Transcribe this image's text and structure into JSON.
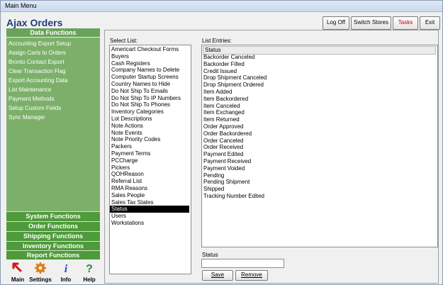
{
  "window": {
    "title": "Main Menu"
  },
  "app": {
    "title": "Ajax Orders"
  },
  "toolbar": {
    "logoff": "Log Off",
    "switch_stores": "Switch Stores",
    "tasks": "Tasks",
    "exit": "Exit",
    "tasks_color": "#c00000"
  },
  "sidebar": {
    "header": "Data Functions",
    "items": [
      "Accounting Export Setup",
      "Assign Carts to Orders",
      "Bronto Contact Export",
      "Clear Transaction Flag",
      "Export Accounting Data",
      "List Maintenance",
      "Payment Methods",
      "Setup Custom Fields",
      "Sync Manager"
    ],
    "sections": [
      "System Functions",
      "Order Functions",
      "Shipping Functions",
      "Inventory Functions",
      "Report Functions"
    ],
    "accent": "#4f9a3a"
  },
  "nav": {
    "main": "Main",
    "settings": "Settings",
    "info": "Info",
    "help": "Help",
    "main_icon": "red-arrow-icon",
    "settings_icon": "gear-icon",
    "info_icon": "info-icon",
    "help_icon": "question-mark-icon"
  },
  "select_list": {
    "label": "Select List:",
    "selected": "Status",
    "items": [
      "Americart Checkout Forms",
      "Buyers",
      "Cash Registers",
      "Company Names to Delete",
      "Computer Startup Screens",
      "Country Names to Hide",
      "Do Not Ship To Emails",
      "Do Not Ship To IP Numbers",
      "Do Not Ship To Phones",
      "Inventory Categories",
      "Lot Descriptions",
      "Note Actions",
      "Note Events",
      "Note Priority Codes",
      "Packers",
      "Payment Terms",
      "PCCharge",
      "Pickers",
      "QOHReason",
      "Referral List",
      "RMA Reasons",
      "Sales People",
      "Sales Tax States",
      "Status",
      "Users",
      "Workstations"
    ]
  },
  "list_entries": {
    "label": "List Entries:",
    "column": "Status",
    "items": [
      "Backorder Canceled",
      "Backorder Filled",
      "Credit Issued",
      "Drop Shipment Canceled",
      "Drop Shipment Ordered",
      "Item Added",
      "Item Backordered",
      "Item Canceled",
      "Item Exchanged",
      "Item Returned",
      "Order Approved",
      "Order Backordered",
      "Order Canceled",
      "Order Received",
      "Payment Edited",
      "Payment Received",
      "Payment Voided",
      "Pending",
      "Pending Shipment",
      "Shipped",
      "Tracking Number Edited"
    ]
  },
  "editor": {
    "label": "Status",
    "value": "",
    "save": "Save",
    "remove": "Remove"
  }
}
